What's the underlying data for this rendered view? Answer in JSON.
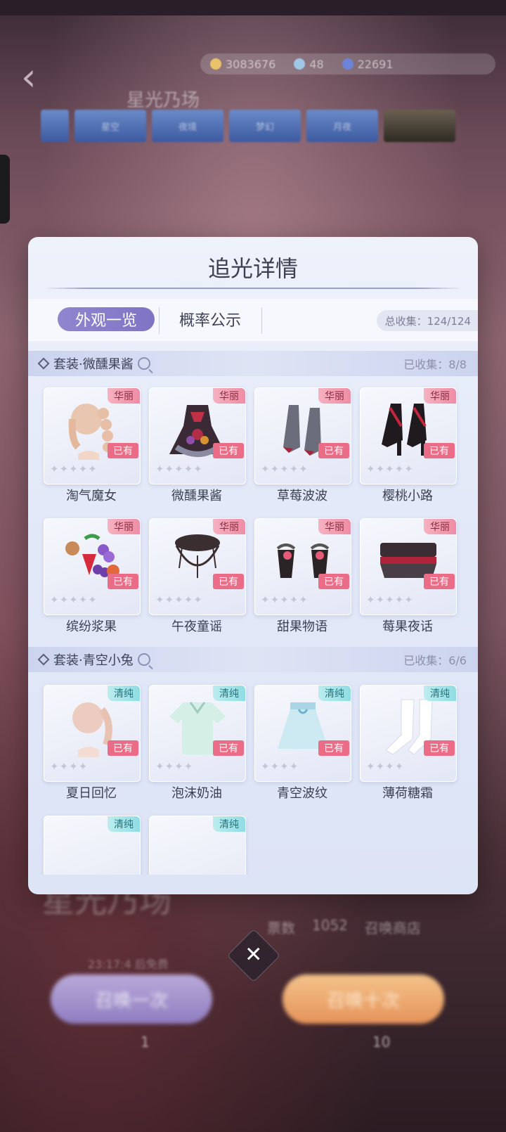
{
  "background": {
    "banner_title": "星光乃场",
    "currency": [
      {
        "icon": "gold-coin-icon",
        "value": "3083676"
      },
      {
        "icon": "diamond-icon",
        "value": "48"
      },
      {
        "icon": "crystal-icon",
        "value": "22691"
      }
    ],
    "pool_tabs": [
      "",
      "星空",
      "夜境",
      "梦幻",
      "月夜",
      ""
    ],
    "bottom": {
      "title": "星光乃场",
      "ticket_label": "票数",
      "ticket_value": "1052",
      "extra": "召唤商店",
      "time": "23:17:4 后免费",
      "draw_one": "召唤一次",
      "draw_ten": "召唤十次",
      "cost_one": "1",
      "cost_ten": "10"
    }
  },
  "modal": {
    "title": "追光详情",
    "tabs": {
      "appearance": "外观一览",
      "probability": "概率公示"
    },
    "total_collect": "总收集：124/124",
    "sections": [
      {
        "title": "套装·微醺果酱",
        "count": "已收集：8/8",
        "items": [
          {
            "name": "淘气魔女",
            "rarity": "华丽",
            "owned": "已有",
            "stars": "✦✦✦✦✦"
          },
          {
            "name": "微醺果酱",
            "rarity": "华丽",
            "owned": "已有",
            "stars": "✦✦✦✦✦"
          },
          {
            "name": "草莓波波",
            "rarity": "华丽",
            "owned": "已有",
            "stars": "✦✦✦✦✦"
          },
          {
            "name": "樱桃小路",
            "rarity": "华丽",
            "owned": "已有",
            "stars": "✦✦✦✦✦"
          },
          {
            "name": "缤纷浆果",
            "rarity": "华丽",
            "owned": "已有",
            "stars": "✦✦✦✦✦"
          },
          {
            "name": "午夜童谣",
            "rarity": "华丽",
            "owned": "已有",
            "stars": "✦✦✦✦✦"
          },
          {
            "name": "甜果物语",
            "rarity": "华丽",
            "owned": "已有",
            "stars": "✦✦✦✦✦"
          },
          {
            "name": "莓果夜话",
            "rarity": "华丽",
            "owned": "已有",
            "stars": "✦✦✦✦✦"
          }
        ]
      },
      {
        "title": "套装·青空小兔",
        "count": "已收集：6/6",
        "items": [
          {
            "name": "夏日回忆",
            "rarity": "清纯",
            "owned": "已有",
            "stars": "✦✦✦✦"
          },
          {
            "name": "泡沫奶油",
            "rarity": "清纯",
            "owned": "已有",
            "stars": "✦✦✦✦"
          },
          {
            "name": "青空波纹",
            "rarity": "清纯",
            "owned": "已有",
            "stars": "✦✦✦✦"
          },
          {
            "name": "薄荷糖霜",
            "rarity": "清纯",
            "owned": "已有",
            "stars": "✦✦✦✦"
          },
          {
            "name": "",
            "rarity": "清纯",
            "owned": "",
            "stars": ""
          },
          {
            "name": "",
            "rarity": "清纯",
            "owned": "",
            "stars": ""
          }
        ]
      }
    ]
  },
  "close": "✕"
}
